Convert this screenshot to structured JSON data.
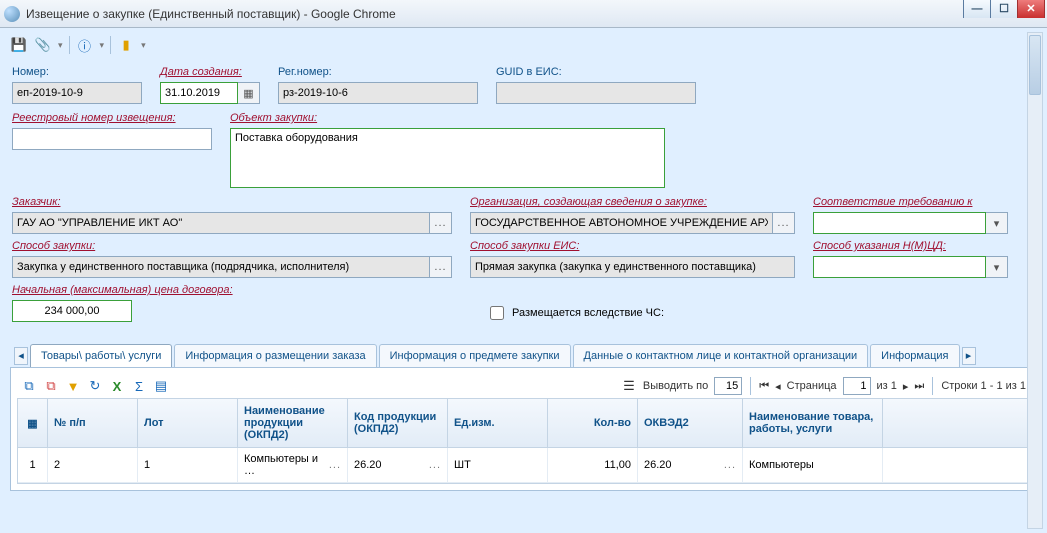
{
  "window": {
    "title": "Извещение о закупке (Единственный поставщик) - Google Chrome"
  },
  "fields": {
    "number": {
      "label": "Номер:",
      "value": "еп-2019-10-9"
    },
    "creation_date": {
      "label": "Дата создания:",
      "value": "31.10.2019"
    },
    "reg_number": {
      "label": "Рег.номер:",
      "value": "рз-2019-10-6"
    },
    "guid": {
      "label": "GUID в ЕИС:",
      "value": ""
    },
    "registry_no": {
      "label": "Реестровый номер извещения:",
      "value": ""
    },
    "object": {
      "label": "Объект закупки:",
      "value": "Поставка оборудования"
    },
    "customer": {
      "label": "Заказчик:",
      "value": "ГАУ АО \"УПРАВЛЕНИЕ ИКТ АО\""
    },
    "org_creator": {
      "label": "Организация, создающая сведения о закупке:",
      "value": "ГОСУДАРСТВЕННОЕ АВТОНОМНОЕ УЧРЕЖДЕНИЕ АРХАН"
    },
    "conformity": {
      "label": "Соответствие требованию к",
      "value": ""
    },
    "method": {
      "label": "Способ закупки:",
      "value": "Закупка у единственного поставщика (подрядчика, исполнителя)"
    },
    "method_eis": {
      "label": "Способ закупки ЕИС:",
      "value": "Прямая закупка (закупка у единственного поставщика)"
    },
    "nmcd_method": {
      "label": "Способ указания Н(М)ЦД:",
      "value": ""
    },
    "nmc": {
      "label": "Начальная (максимальная) цена договора:",
      "value": "234 000,00"
    },
    "emergency": {
      "label": "Размещается вследствие ЧС:"
    }
  },
  "tabs": [
    "Товары\\ работы\\ услуги",
    "Информация о размещении заказа",
    "Информация о предмете закупки",
    "Данные о контактном лице и контактной организации",
    "Информация"
  ],
  "pager": {
    "out_by": "Выводить по",
    "per_page": "15",
    "page_lbl": "Страница",
    "page": "1",
    "of": "из 1",
    "rows": "Строки 1 - 1 из 1"
  },
  "grid": {
    "headers": {
      "h1": "№ п/п",
      "h2": "Лот",
      "h3": "Наименование продукции (ОКПД2)",
      "h4": "Код продукции (ОКПД2)",
      "h5": "Ед.изм.",
      "h6": "Кол-во",
      "h7": "ОКВЭД2",
      "h8": "Наименование товара, работы, услуги"
    },
    "row": {
      "idx": "1",
      "npp": "2",
      "lot": "1",
      "prod_name": "Компьютеры и …",
      "prod_code": "26.20",
      "unit": "ШТ",
      "qty": "11,00",
      "okved": "26.20",
      "tws_name": "Компьютеры"
    }
  }
}
